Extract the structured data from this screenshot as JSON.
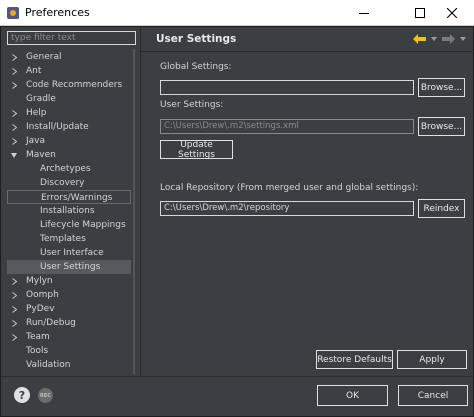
{
  "window": {
    "title": "Preferences"
  },
  "sidebar": {
    "filter_placeholder": "type filter text",
    "items": [
      {
        "label": "General",
        "expandable": true,
        "expanded": false,
        "child": false
      },
      {
        "label": "Ant",
        "expandable": true,
        "expanded": false,
        "child": false
      },
      {
        "label": "Code Recommenders",
        "expandable": true,
        "expanded": false,
        "child": false
      },
      {
        "label": "Gradle",
        "expandable": false,
        "expanded": false,
        "child": false
      },
      {
        "label": "Help",
        "expandable": true,
        "expanded": false,
        "child": false
      },
      {
        "label": "Install/Update",
        "expandable": true,
        "expanded": false,
        "child": false
      },
      {
        "label": "Java",
        "expandable": true,
        "expanded": false,
        "child": false
      },
      {
        "label": "Maven",
        "expandable": true,
        "expanded": true,
        "child": false
      },
      {
        "label": "Archetypes",
        "expandable": false,
        "expanded": false,
        "child": true
      },
      {
        "label": "Discovery",
        "expandable": false,
        "expanded": false,
        "child": true
      },
      {
        "label": "Errors/Warnings",
        "expandable": false,
        "expanded": false,
        "child": true
      },
      {
        "label": "Installations",
        "expandable": false,
        "expanded": false,
        "child": true
      },
      {
        "label": "Lifecycle Mappings",
        "expandable": false,
        "expanded": false,
        "child": true
      },
      {
        "label": "Templates",
        "expandable": false,
        "expanded": false,
        "child": true
      },
      {
        "label": "User Interface",
        "expandable": false,
        "expanded": false,
        "child": true
      },
      {
        "label": "User Settings",
        "expandable": false,
        "expanded": false,
        "child": true
      },
      {
        "label": "Mylyn",
        "expandable": true,
        "expanded": false,
        "child": false
      },
      {
        "label": "Oomph",
        "expandable": true,
        "expanded": false,
        "child": false
      },
      {
        "label": "PyDev",
        "expandable": true,
        "expanded": false,
        "child": false
      },
      {
        "label": "Run/Debug",
        "expandable": true,
        "expanded": false,
        "child": false
      },
      {
        "label": "Team",
        "expandable": true,
        "expanded": false,
        "child": false
      },
      {
        "label": "Tools",
        "expandable": false,
        "expanded": false,
        "child": false
      },
      {
        "label": "Validation",
        "expandable": false,
        "expanded": false,
        "child": false
      }
    ],
    "selected_item": "User Settings",
    "outlined_item": "Errors/Warnings"
  },
  "page": {
    "title": "User Settings",
    "global_settings_label": "Global Settings:",
    "global_settings_value": "",
    "user_settings_label": "User Settings:",
    "user_settings_value": "C:\\Users\\Drew\\.m2\\settings.xml",
    "browse_label": "Browse...",
    "update_settings_label": "Update Settings",
    "local_repo_label": "Local Repository (From merged user and global settings):",
    "local_repo_value": "C:\\Users\\Drew\\.m2\\repository",
    "reindex_label": "Reindex",
    "restore_defaults_label": "Restore Defaults",
    "apply_label": "Apply"
  },
  "footer": {
    "help_glyph": "?",
    "oomph_glyph": "REC",
    "ok_label": "OK",
    "cancel_label": "Cancel"
  },
  "colors": {
    "background": "#3c3f41",
    "nav_back_arrow": "#f5c400",
    "selection": "#575a5c"
  },
  "icons": {
    "back": "arrow-left-icon",
    "forward": "arrow-right-icon",
    "menu": "chevron-down-icon"
  }
}
